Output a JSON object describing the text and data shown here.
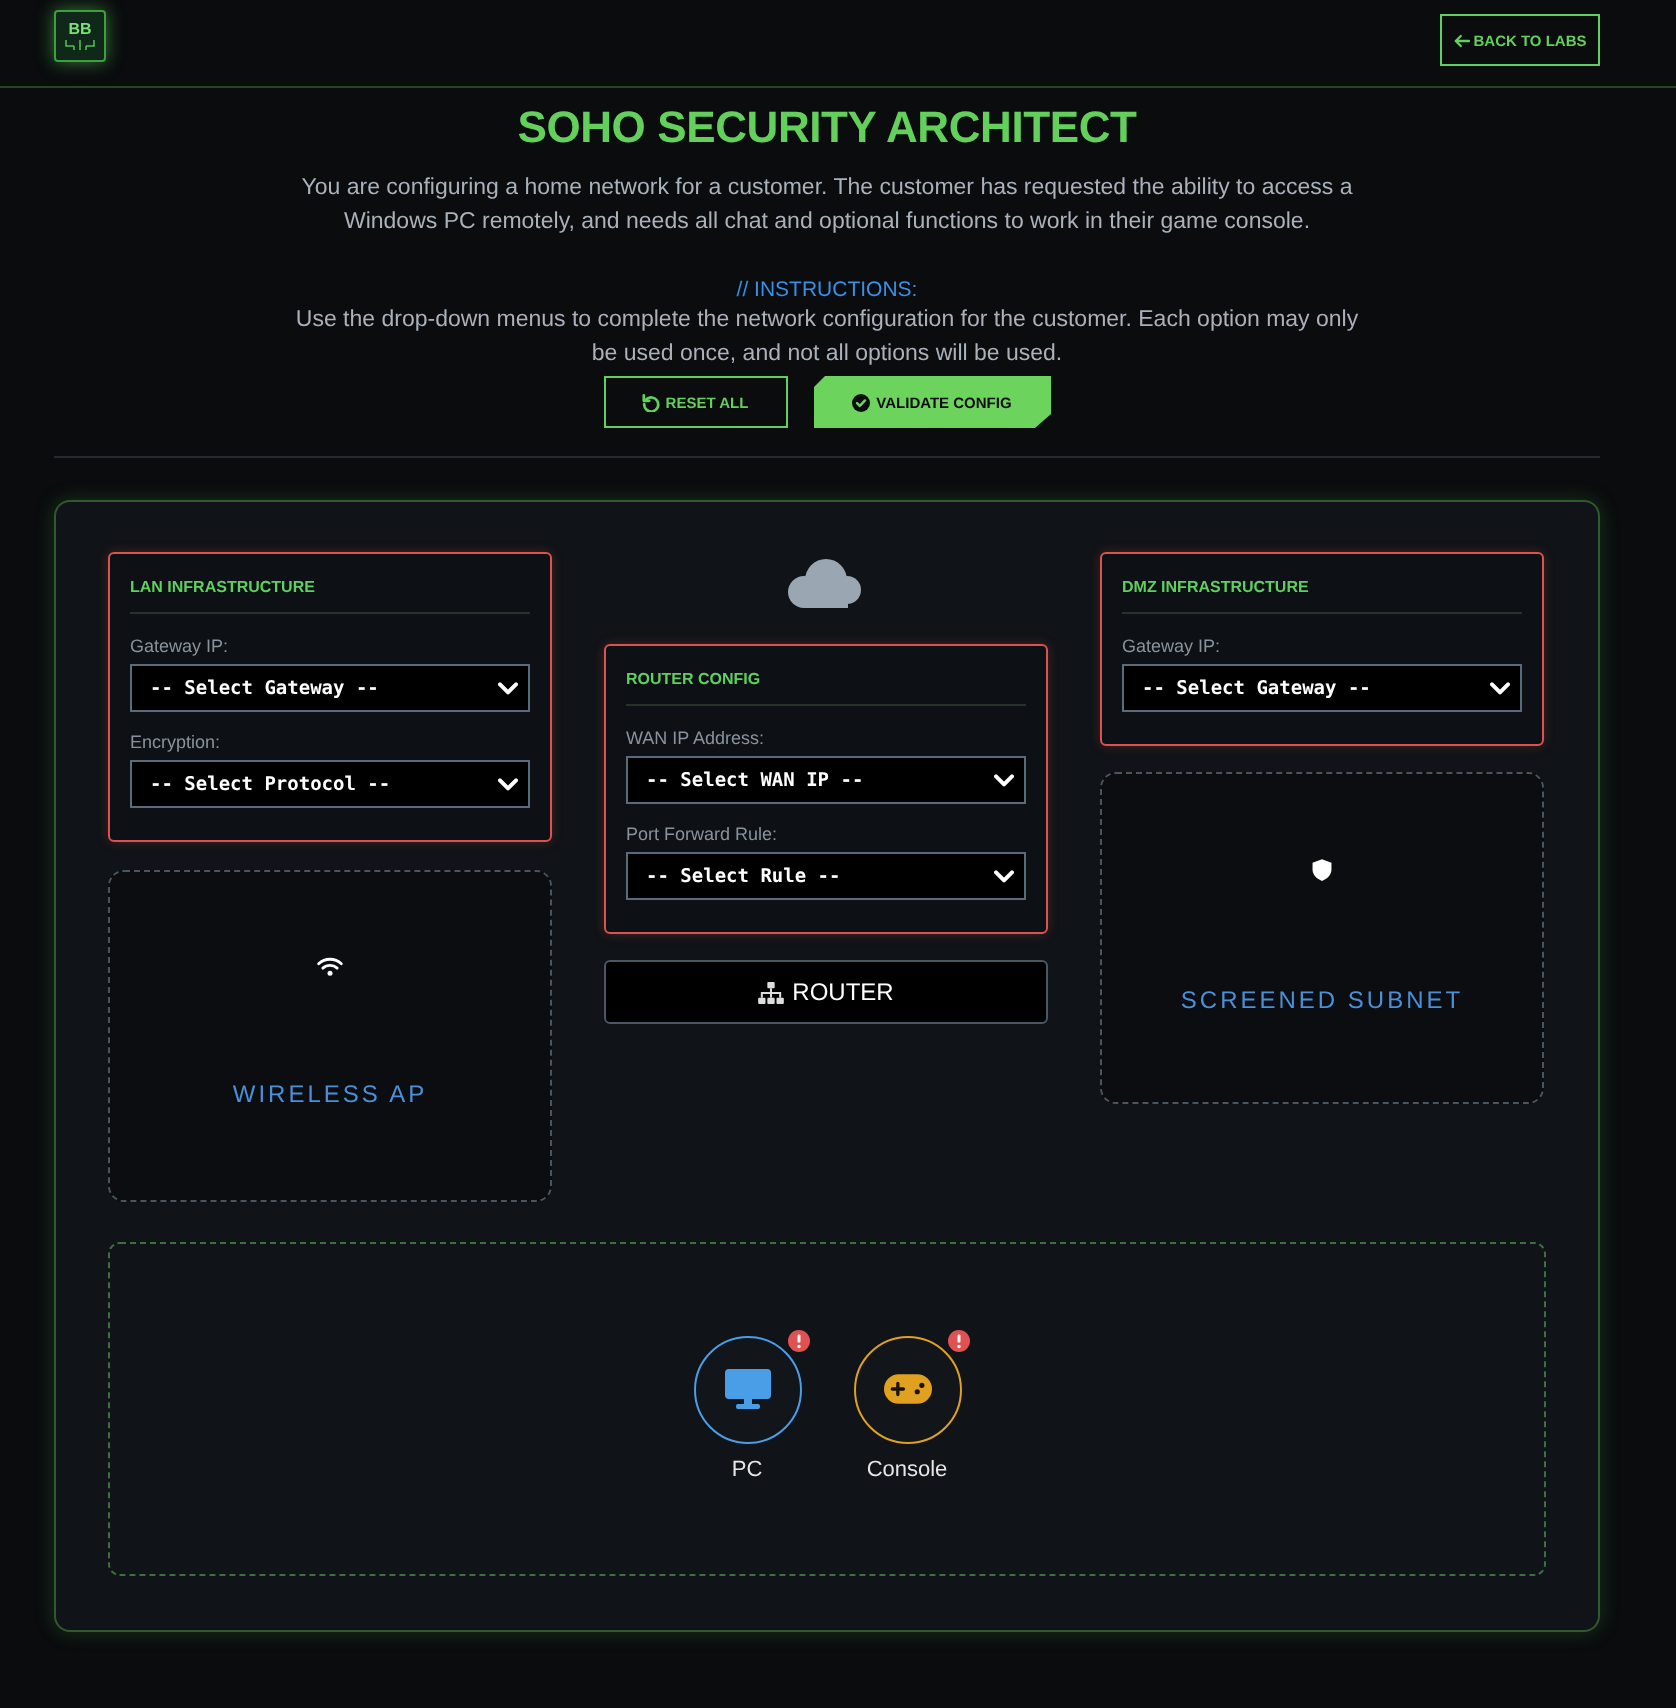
{
  "header": {
    "logo_text": "BB",
    "back_button": "BACK TO LABS"
  },
  "intro": {
    "title": "SOHO SECURITY ARCHITECT",
    "description": "You are configuring a home network for a customer. The customer has requested the ability to access a Windows PC remotely, and needs all chat and optional functions to work in their game console.",
    "instructions_label": "// INSTRUCTIONS:",
    "instructions": "Use the drop-down menus to complete the network configuration for the customer. Each option may only be used once, and not all options will be used."
  },
  "actions": [
    {
      "kind": "reset",
      "label": "RESET ALL"
    },
    {
      "kind": "validate",
      "label": "VALIDATE CONFIG"
    }
  ],
  "lan": {
    "config": {
      "title": "LAN INFRASTRUCTURE",
      "complete": false,
      "fields": [
        {
          "label": "Gateway IP:",
          "value": "-- Select Gateway --"
        },
        {
          "label": "Encryption:",
          "value": "-- Select Protocol --"
        }
      ]
    },
    "zone": {
      "kind": "wifi",
      "label": "WIRELESS AP"
    }
  },
  "router": {
    "config": {
      "title": "ROUTER CONFIG",
      "complete": false,
      "fields": [
        {
          "label": "WAN IP Address:",
          "value": "-- Select WAN IP --"
        },
        {
          "label": "Port Forward Rule:",
          "value": "-- Select Rule --"
        }
      ]
    },
    "button": "ROUTER"
  },
  "dmz": {
    "config": {
      "title": "DMZ INFRASTRUCTURE",
      "complete": false,
      "fields": [
        {
          "label": "Gateway IP:",
          "value": "-- Select Gateway --"
        }
      ]
    },
    "zone": {
      "kind": "shield",
      "label": "SCREENED SUBNET"
    }
  },
  "devices": [
    {
      "kind": "pc",
      "label": "PC",
      "color": "#4a9ee8",
      "alert": true
    },
    {
      "kind": "console",
      "label": "Console",
      "color": "#e0a020",
      "alert": true
    }
  ]
}
